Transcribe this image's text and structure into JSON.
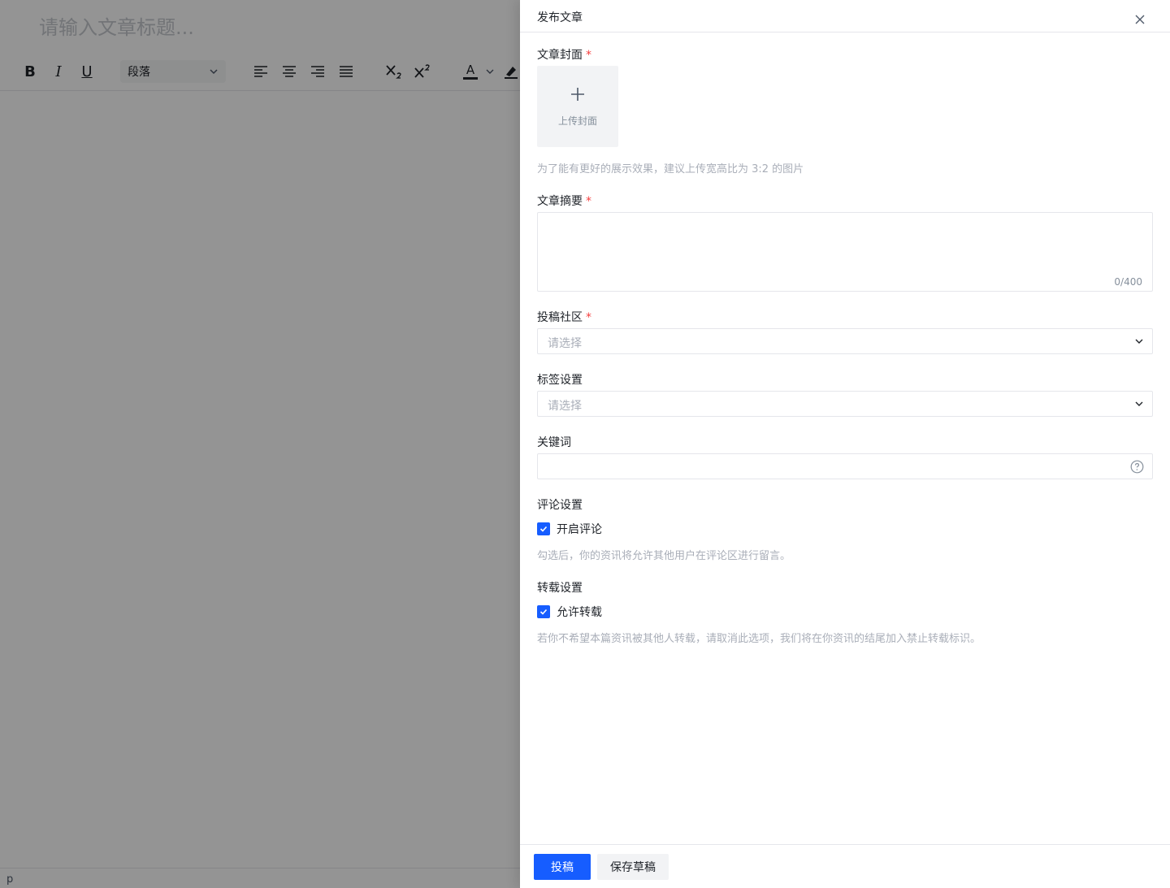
{
  "editor": {
    "title_placeholder": "请输入文章标题...",
    "paragraph_select": "段落",
    "status_text": "p",
    "toolbar": {
      "bold": "B",
      "italic": "I",
      "underline": "U",
      "text_color": "A"
    }
  },
  "drawer": {
    "title": "发布文章",
    "cover": {
      "label": "文章封面",
      "required_mark": "*",
      "upload_text": "上传封面",
      "hint": "为了能有更好的展示效果，建议上传宽高比为 3:2 的图片"
    },
    "summary": {
      "label": "文章摘要",
      "required_mark": "*",
      "counter": "0/400"
    },
    "community": {
      "label": "投稿社区",
      "required_mark": "*",
      "placeholder": "请选择"
    },
    "tags": {
      "label": "标签设置",
      "placeholder": "请选择"
    },
    "keywords": {
      "label": "关键词"
    },
    "comments": {
      "label": "评论设置",
      "checkbox_label": "开启评论",
      "checked": true,
      "hint": "勾选后，你的资讯将允许其他用户在评论区进行留言。"
    },
    "repost": {
      "label": "转载设置",
      "checkbox_label": "允许转载",
      "checked": true,
      "hint": "若你不希望本篇资讯被其他人转载，请取消此选项，我们将在你资讯的结尾加入禁止转载标识。"
    },
    "footer": {
      "submit_label": "投稿",
      "save_draft_label": "保存草稿"
    }
  },
  "colors": {
    "primary": "#165dff",
    "required": "#f53f3f",
    "hint": "#a9aeb8"
  }
}
